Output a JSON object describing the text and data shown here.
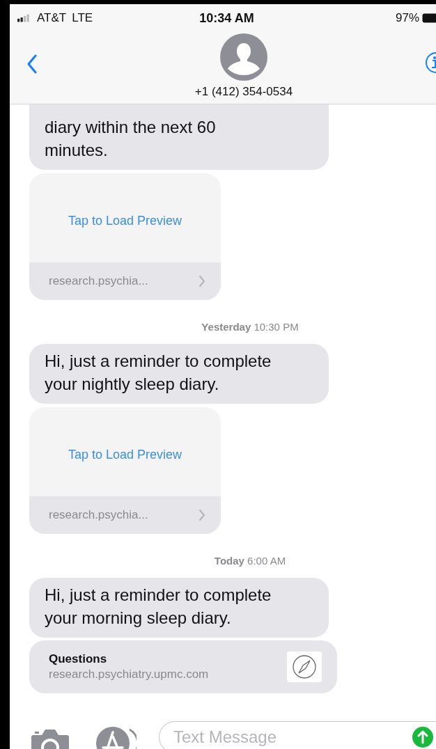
{
  "status_bar": {
    "carrier": "AT&T",
    "network": "LTE",
    "time": "10:34 AM",
    "battery": "97%"
  },
  "header": {
    "contact": "+1 (412) 354-0534"
  },
  "messages": [
    {
      "kind": "text",
      "text": "diary within the next 60\nminutes."
    },
    {
      "kind": "preview",
      "action": "Tap to Load Preview",
      "domain": "research.psychia..."
    },
    {
      "kind": "timestamp",
      "day": "Yesterday",
      "time": "10:30 PM"
    },
    {
      "kind": "text",
      "text": "Hi, just a reminder to complete\nyour nightly sleep diary."
    },
    {
      "kind": "preview",
      "action": "Tap to Load Preview",
      "domain": "research.psychia..."
    },
    {
      "kind": "timestamp",
      "day": "Today",
      "time": "6:00 AM"
    },
    {
      "kind": "text",
      "text": "Hi, just a reminder to complete\nyour morning sleep diary."
    },
    {
      "kind": "link",
      "title": "Questions",
      "url": "research.psychiatry.upmc.com"
    }
  ],
  "composer": {
    "placeholder": "Text Message"
  }
}
